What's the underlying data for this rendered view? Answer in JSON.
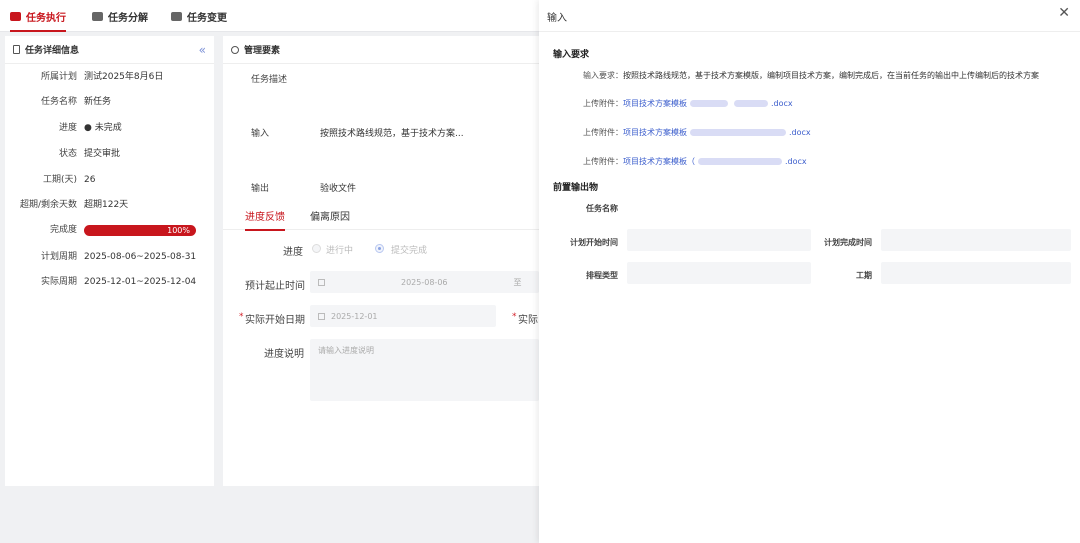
{
  "tabs": [
    {
      "label": "任务执行",
      "icon": "truck-icon",
      "active": true
    },
    {
      "label": "任务分解",
      "icon": "folder-icon",
      "active": false
    },
    {
      "label": "任务变更",
      "icon": "folder-icon",
      "active": false
    }
  ],
  "left": {
    "title": "任务详细信息",
    "collapse": "«",
    "rows": [
      {
        "label": "所属计划",
        "value": "测试2025年8月6日"
      },
      {
        "label": "任务名称",
        "value": "新任务"
      },
      {
        "label": "进度",
        "value": "● 未完成"
      },
      {
        "label": "状态",
        "value": "提交审批"
      },
      {
        "label": "工期(天)",
        "value": "26"
      },
      {
        "label": "超期/剩余天数",
        "value": "超期122天"
      },
      {
        "label": "完成度",
        "value": "100%",
        "progress": 1.0
      },
      {
        "label": "计划周期",
        "value": "2025-08-06~2025-08-31"
      },
      {
        "label": "实际周期",
        "value": "2025-12-01~2025-12-04"
      }
    ]
  },
  "middle": {
    "title": "管理要素",
    "task_desc_label": "任务描述",
    "input_label": "输入",
    "input_value": "按照技术路线规范，基于技术方案...",
    "output_label": "输出",
    "output_value": "验收文件",
    "subtabs": [
      "进度反馈",
      "偏离原因"
    ],
    "progress_label": "进度",
    "progress_options": [
      "进行中",
      "提交完成"
    ],
    "est_label": "预计起止时间",
    "est_value": "2025-08-06",
    "est_value2": "至",
    "actual_start_label": "实际开始日期",
    "actual_start_value": "2025-12-01",
    "actual_end_label": "实际",
    "desc_label": "进度说明",
    "desc_placeholder": "请输入进度说明"
  },
  "drawer": {
    "title": "输入",
    "close": "✕",
    "sec1": "输入要求",
    "req_label": "输入要求：",
    "req_value": "按照技术路线规范，基于技术方案模版，编制项目技术方案，编制完成后，在当前任务的输出中上传编制后的技术方案",
    "attach_label": "上传附件：",
    "attachments": [
      {
        "name": "项目技术方案模板",
        "ext": ".docx"
      },
      {
        "name": "项目技术方案模板",
        "ext": ".docx"
      },
      {
        "name": "项目技术方案模板（",
        "ext": ".docx"
      }
    ],
    "sec2": "前置输出物",
    "task_name_label": "任务名称",
    "plan_start_label": "计划开始时间",
    "plan_end_label": "计划完成时间",
    "sched_type_label": "排程类型",
    "duration_label": "工期"
  }
}
